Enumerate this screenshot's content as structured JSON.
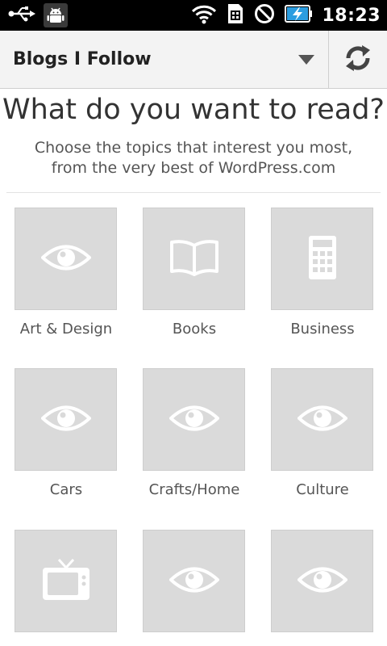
{
  "status_bar": {
    "time": "18:23",
    "icons": [
      "usb-icon",
      "android-debug-icon",
      "wifi-icon",
      "sim-icon",
      "no-signal-icon",
      "battery-charging-icon"
    ]
  },
  "action_bar": {
    "title": "Blogs I Follow",
    "dropdown_icon": "triangle-down-icon",
    "refresh_icon": "refresh-icon"
  },
  "main": {
    "heading": "What do you want to read?",
    "subtitle_line1": "Choose the topics that interest you most,",
    "subtitle_line2": "from the very best of WordPress.com"
  },
  "topics": [
    {
      "label": "Art & Design",
      "icon": "eye-icon"
    },
    {
      "label": "Books",
      "icon": "book-icon"
    },
    {
      "label": "Business",
      "icon": "calculator-icon"
    },
    {
      "label": "Cars",
      "icon": "eye-icon"
    },
    {
      "label": "Crafts/Home",
      "icon": "eye-icon"
    },
    {
      "label": "Culture",
      "icon": "eye-icon"
    },
    {
      "label": "",
      "icon": "tv-icon"
    },
    {
      "label": "",
      "icon": "eye-icon"
    },
    {
      "label": "",
      "icon": "eye-icon"
    }
  ],
  "colors": {
    "tile_bg": "#dadada",
    "icon_fill": "#ffffff",
    "actionbar_bg": "#f3f3f3"
  }
}
